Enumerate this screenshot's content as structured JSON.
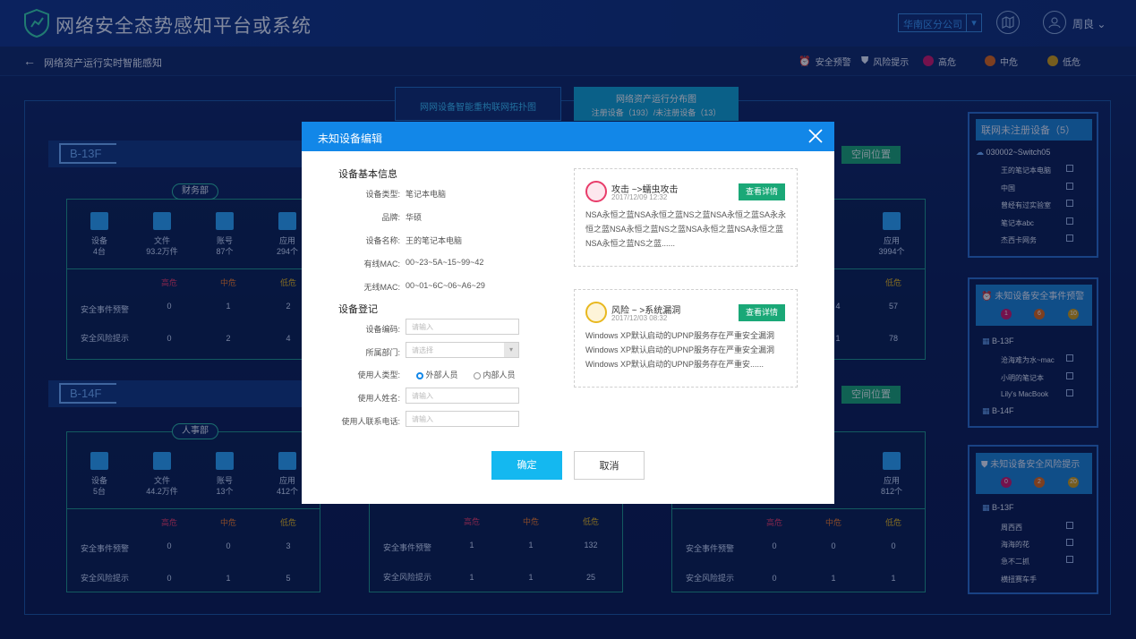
{
  "app": {
    "title": "网络安全态势感知平台或系统",
    "company": "华南区分公司",
    "user": "周良"
  },
  "subbar": {
    "back": "←",
    "title": "网络资产运行实时智能感知"
  },
  "legend": {
    "safety_warning": "安全预警",
    "risk_tip": "风险提示",
    "high": "高危",
    "mid": "中危",
    "low": "低危"
  },
  "tabs": {
    "topology": "网网设备智能重构联网拓扑图",
    "distribution": "网络资产运行分布图",
    "distribution_sub": "注册设备（193）/未注册设备（13）"
  },
  "zones": {
    "b13": "B-13F",
    "b14": "B-14F",
    "space_btn": "空间位置"
  },
  "dept1": {
    "name": "财务部",
    "stats": [
      {
        "label": "设备",
        "value": "4台"
      },
      {
        "label": "文件",
        "value": "93.2万件"
      },
      {
        "label": "账号",
        "value": "87个"
      },
      {
        "label": "应用",
        "value": "294个"
      }
    ],
    "rows": [
      {
        "name": "安全事件预警",
        "vals": [
          "0",
          "1",
          "2"
        ]
      },
      {
        "name": "安全风险提示",
        "vals": [
          "0",
          "2",
          "4"
        ]
      }
    ]
  },
  "dept_r1": {
    "app": "应用",
    "app_val": "3994个",
    "rows": [
      [
        "4",
        "57"
      ],
      [
        "1",
        "78"
      ]
    ],
    "partial": "个"
  },
  "dept2": {
    "name": "人事部",
    "stats": [
      {
        "label": "设备",
        "value": "5台"
      },
      {
        "label": "文件",
        "value": "44.2万件"
      },
      {
        "label": "账号",
        "value": "13个"
      },
      {
        "label": "应用",
        "value": "412个"
      }
    ],
    "rows": [
      {
        "name": "安全事件预警",
        "vals": [
          "0",
          "0",
          "3"
        ]
      },
      {
        "name": "安全风险提示",
        "vals": [
          "0",
          "1",
          "5"
        ]
      }
    ]
  },
  "dept3": {
    "rows": [
      {
        "name": "安全事件预警",
        "vals": [
          "1",
          "1",
          "132"
        ]
      },
      {
        "name": "安全风险提示",
        "vals": [
          "1",
          "1",
          "25"
        ]
      }
    ]
  },
  "dept4": {
    "app": "应用",
    "app_val": "812个",
    "rows": [
      {
        "name": "安全事件预警",
        "vals": [
          "0",
          "0",
          "0"
        ]
      },
      {
        "name": "安全风险提示",
        "vals": [
          "0",
          "1",
          "1"
        ]
      }
    ]
  },
  "sev_headers": [
    "高危",
    "中危",
    "低危"
  ],
  "right1": {
    "title": "联网未注册设备（5）",
    "switch": "030002~Switch05",
    "items": [
      "王的笔记本电脑",
      "中国",
      "曾经有过实验室",
      "笔记本abc",
      "杰西卡网务"
    ]
  },
  "right2": {
    "title": "未知设备安全事件预警",
    "counts": [
      "1",
      "6",
      "10"
    ],
    "floor1": "B-13F",
    "items": [
      "沧海难为水~mac",
      "小明的笔记本",
      "Lily's MacBook"
    ],
    "floor2": "B-14F"
  },
  "right3": {
    "title": "未知设备安全风险提示",
    "counts": [
      "0",
      "2",
      "20"
    ],
    "floor1": "B-13F",
    "items": [
      "周西西",
      "海海的花",
      "急不二抓",
      "横扭赛车手"
    ]
  },
  "modal": {
    "title": "未知设备编辑",
    "basic_title": "设备基本信息",
    "basic": [
      {
        "label": "设备类型:",
        "value": "笔记本电脑"
      },
      {
        "label": "品牌:",
        "value": "华硕"
      },
      {
        "label": "设备名称:",
        "value": "王的笔记本电脑"
      },
      {
        "label": "有线MAC:",
        "value": "00~23~5A~15~99~42"
      },
      {
        "label": "无线MAC:",
        "value": "00~01~6C~06~A6~29"
      }
    ],
    "reg_title": "设备登记",
    "code_label": "设备编码:",
    "code_ph": "请输入",
    "dept_label": "所属部门:",
    "dept_ph": "请选择",
    "usertype_label": "使用人类型:",
    "usertype_ext": "外部人员",
    "usertype_int": "内部人员",
    "name_label": "使用人姓名:",
    "name_ph": "请输入",
    "phone_label": "使用人联系电话:",
    "phone_ph": "请输入",
    "card1": {
      "title": "攻击 ~>蠕虫攻击",
      "date": "2017/12/09 12:32",
      "btn": "查看详情",
      "body": "NSA永恒之蓝NSA永恒之蓝NS之蓝NSA永恒之蓝SA永永恒之蓝NSA永恒之蓝NS之蓝NSA永恒之蓝NSA永恒之蓝NSA永恒之蓝NS之蓝......"
    },
    "card2": {
      "title": "风险 ~ >系统漏洞",
      "date": "2017/12/03 08:32",
      "btn": "查看详情",
      "body": "Windows XP默认启动的UPNP服务存在严重安全漏洞 Windows XP默认启动的UPNP服务存在严重安全漏洞 Windows XP默认启动的UPNP服务存在严重安......"
    },
    "ok": "确定",
    "cancel": "取消"
  }
}
